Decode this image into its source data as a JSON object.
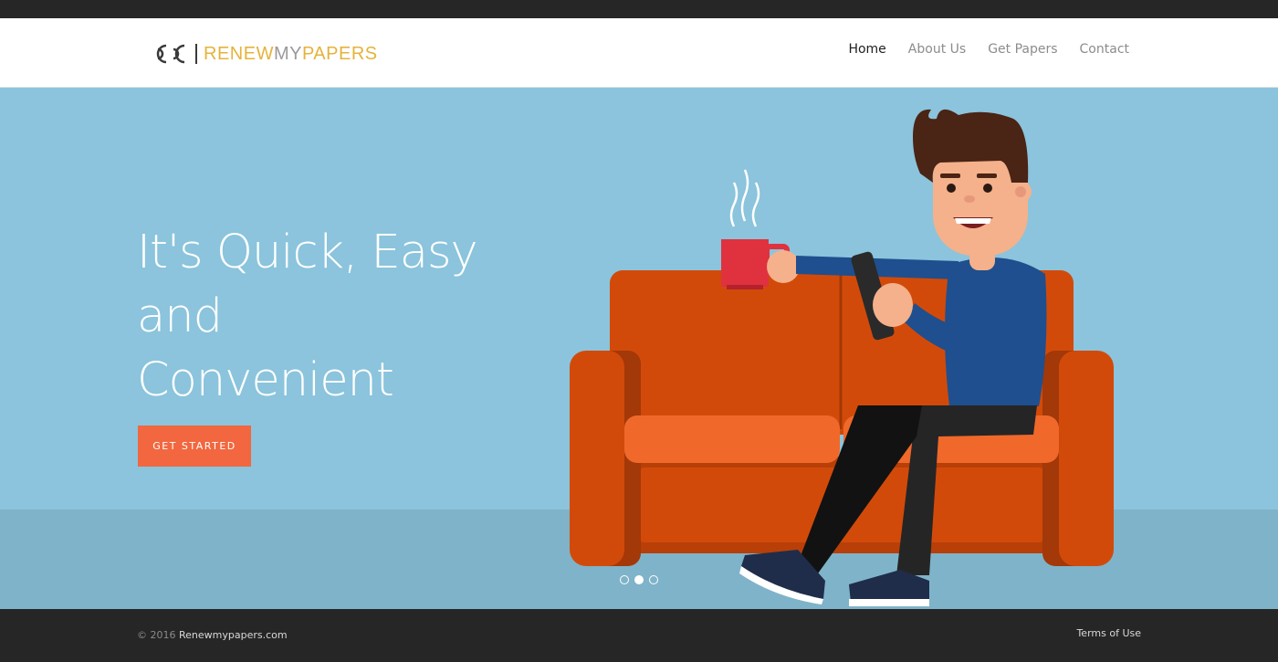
{
  "brand": {
    "name_part1": "RENEW",
    "name_part2": "MY",
    "name_part3": "PAPERS",
    "accent_color": "#e5b33a",
    "gray_color": "#9a9a9a"
  },
  "nav": {
    "items": [
      {
        "label": "Home",
        "active": true
      },
      {
        "label": "About Us",
        "active": false
      },
      {
        "label": "Get Papers",
        "active": false
      },
      {
        "label": "Contact",
        "active": false
      }
    ]
  },
  "hero": {
    "headline_lines": [
      "It's Quick, Easy",
      "and",
      "Convenient"
    ],
    "cta_label": "GET STARTED",
    "background_color": "#8bc4dc",
    "cta_color": "#f2673f",
    "illustration_icon": "man-on-couch-with-coffee-illustration",
    "carousel": {
      "slide_count": 3,
      "active_slide": 2
    }
  },
  "footer": {
    "copyright_prefix": "© 2016",
    "copyright_link": "Renewmypapers.com",
    "terms_label": "Terms of Use"
  }
}
